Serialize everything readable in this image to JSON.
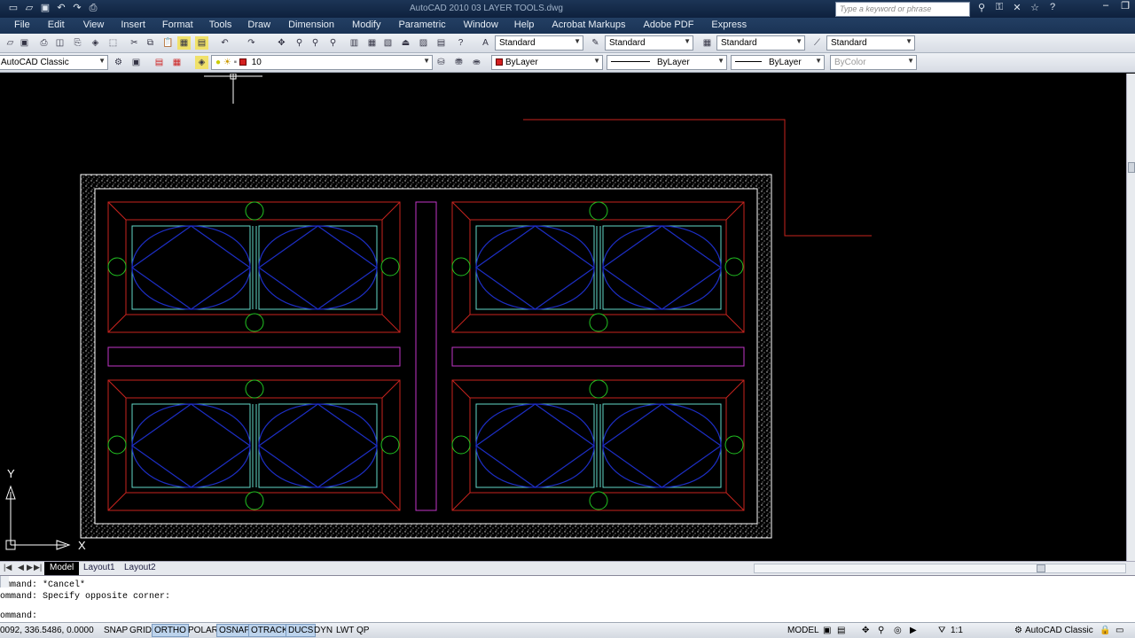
{
  "title_bar": {
    "app_title": "AutoCAD 2010      03 LAYER TOOLS.dwg",
    "search_placeholder": "Type a keyword or phrase"
  },
  "menu": [
    "File",
    "Edit",
    "View",
    "Insert",
    "Format",
    "Tools",
    "Draw",
    "Dimension",
    "Modify",
    "Parametric",
    "Window",
    "Help",
    "Acrobat Markups",
    "Adobe PDF",
    "Express"
  ],
  "toolbar_styles": {
    "text_style": "Standard",
    "dim_style": "Standard",
    "table_style": "Standard",
    "mleader_style": "Standard"
  },
  "workspace_combo": "AutoCAD Classic",
  "layer_combo": "10",
  "properties": {
    "color": "ByLayer",
    "linetype": "ByLayer",
    "lineweight": "ByLayer",
    "plotstyle": "ByColor"
  },
  "ucs": {
    "y_label": "Y",
    "x_label": "X"
  },
  "tabs": [
    "Model",
    "Layout1",
    "Layout2"
  ],
  "command_lines": [
    "ommand: *Cancel*",
    "ommand: Specify opposite corner:",
    "ommand:"
  ],
  "status": {
    "coords": "0092, 336.5486, 0.0000",
    "toggles": [
      {
        "label": "SNAP",
        "on": false
      },
      {
        "label": "GRID",
        "on": false
      },
      {
        "label": "ORTHO",
        "on": true
      },
      {
        "label": "POLAR",
        "on": false
      },
      {
        "label": "OSNAP",
        "on": true
      },
      {
        "label": "OTRACK",
        "on": true
      },
      {
        "label": "DUCS",
        "on": true
      },
      {
        "label": "DYN",
        "on": false
      },
      {
        "label": "LWT",
        "on": false
      },
      {
        "label": "QP",
        "on": false
      }
    ],
    "space": "MODEL",
    "scale": "1:1",
    "workspace": "AutoCAD Classic"
  },
  "colors": {
    "red": "#c8231e",
    "green": "#22c422",
    "blue": "#1d2ec4",
    "cyan": "#62d9c9",
    "magenta": "#c236c9",
    "white": "#ffffff"
  }
}
